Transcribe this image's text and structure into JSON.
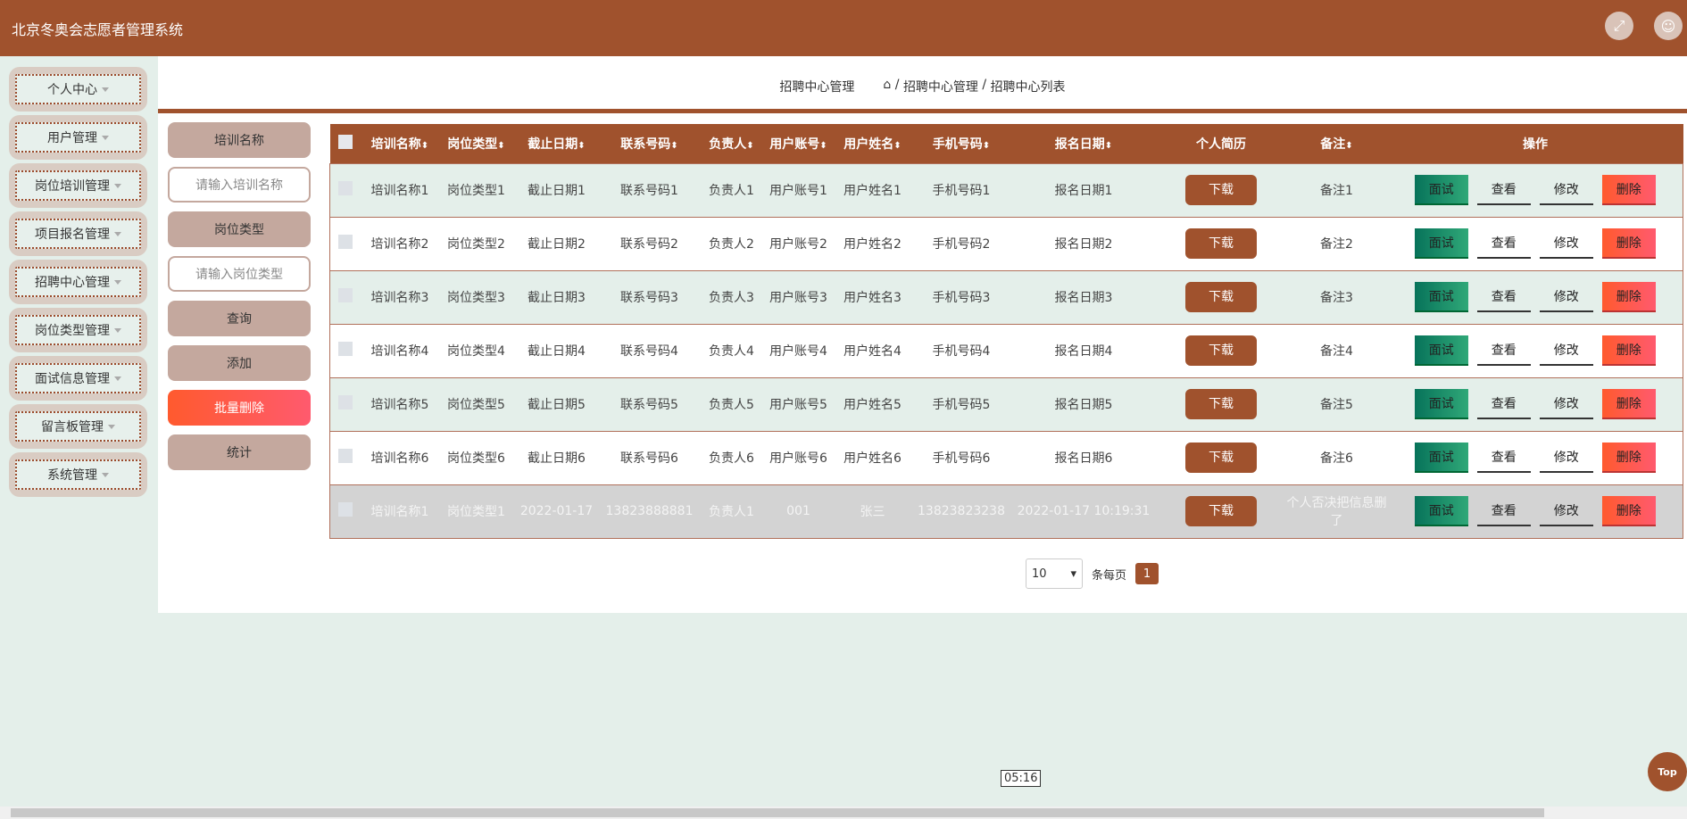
{
  "app_title": "北京冬奥会志愿者管理系统",
  "header_icons": [
    "fullscreen-icon",
    "user-icon"
  ],
  "sidebar": [
    "个人中心",
    "用户管理",
    "岗位培训管理",
    "项目报名管理",
    "招聘中心管理",
    "岗位类型管理",
    "面试信息管理",
    "留言板管理",
    "系统管理"
  ],
  "breadcrumb": {
    "title": "招聘中心管理",
    "path1": "招聘中心管理",
    "path2": "招聘中心列表",
    "sep": "/"
  },
  "search": {
    "label1": "培训名称",
    "placeholder1": "请输入培训名称",
    "label2": "岗位类型",
    "placeholder2": "请输入岗位类型",
    "query": "查询",
    "add": "添加",
    "batch_delete": "批量删除",
    "stats": "统计"
  },
  "table": {
    "headers": [
      "培训名称",
      "岗位类型",
      "截止日期",
      "联系号码",
      "负责人",
      "用户账号",
      "用户姓名",
      "手机号码",
      "报名日期",
      "个人简历",
      "备注",
      "操作"
    ],
    "rows": [
      [
        "培训名称1",
        "岗位类型1",
        "截止日期1",
        "联系号码1",
        "负责人1",
        "用户账号1",
        "用户姓名1",
        "手机号码1",
        "报名日期1",
        "备注1"
      ],
      [
        "培训名称2",
        "岗位类型2",
        "截止日期2",
        "联系号码2",
        "负责人2",
        "用户账号2",
        "用户姓名2",
        "手机号码2",
        "报名日期2",
        "备注2"
      ],
      [
        "培训名称3",
        "岗位类型3",
        "截止日期3",
        "联系号码3",
        "负责人3",
        "用户账号3",
        "用户姓名3",
        "手机号码3",
        "报名日期3",
        "备注3"
      ],
      [
        "培训名称4",
        "岗位类型4",
        "截止日期4",
        "联系号码4",
        "负责人4",
        "用户账号4",
        "用户姓名4",
        "手机号码4",
        "报名日期4",
        "备注4"
      ],
      [
        "培训名称5",
        "岗位类型5",
        "截止日期5",
        "联系号码5",
        "负责人5",
        "用户账号5",
        "用户姓名5",
        "手机号码5",
        "报名日期5",
        "备注5"
      ],
      [
        "培训名称6",
        "岗位类型6",
        "截止日期6",
        "联系号码6",
        "负责人6",
        "用户账号6",
        "用户姓名6",
        "手机号码6",
        "报名日期6",
        "备注6"
      ],
      [
        "培训名称1",
        "岗位类型1",
        "2022-01-17",
        "13823888881",
        "负责人1",
        "001",
        "张三",
        "13823823238",
        "2022-01-17 10:19:31",
        "个人否决把信息删了"
      ]
    ],
    "download": "下载",
    "actions": [
      "面试",
      "查看",
      "修改",
      "删除"
    ]
  },
  "pager": {
    "page_size": "10",
    "per_page_label": "条每页",
    "current": "1"
  },
  "time": "05:16",
  "top_label": "Top"
}
